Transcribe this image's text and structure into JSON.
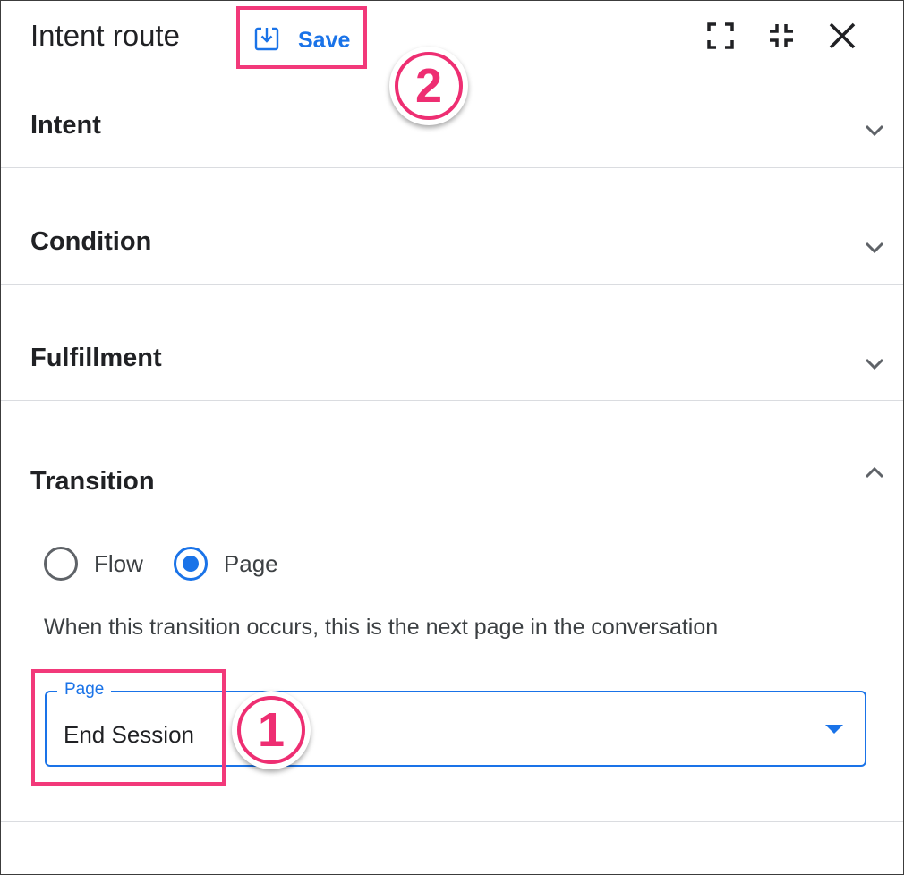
{
  "panel": {
    "title": "Intent route",
    "save_label": "Save",
    "header_icons": [
      "fullscreen-icon",
      "exit-fullscreen-icon",
      "close-icon"
    ]
  },
  "sections": [
    {
      "label": "Intent",
      "expanded": false
    },
    {
      "label": "Condition",
      "expanded": false
    },
    {
      "label": "Fulfillment",
      "expanded": false
    },
    {
      "label": "Transition",
      "expanded": true
    }
  ],
  "transition": {
    "options": [
      {
        "label": "Flow",
        "selected": false
      },
      {
        "label": "Page",
        "selected": true
      }
    ],
    "description": "When this transition occurs, this is the next page in the conversation",
    "page_field": {
      "label": "Page",
      "value": "End Session"
    }
  },
  "annotations": [
    {
      "text": "①",
      "color": "#ee2e72"
    },
    {
      "text": "②",
      "color": "#ee2e72"
    }
  ],
  "colors": {
    "accent": "#1a73e8",
    "highlight": "#f2397a"
  }
}
